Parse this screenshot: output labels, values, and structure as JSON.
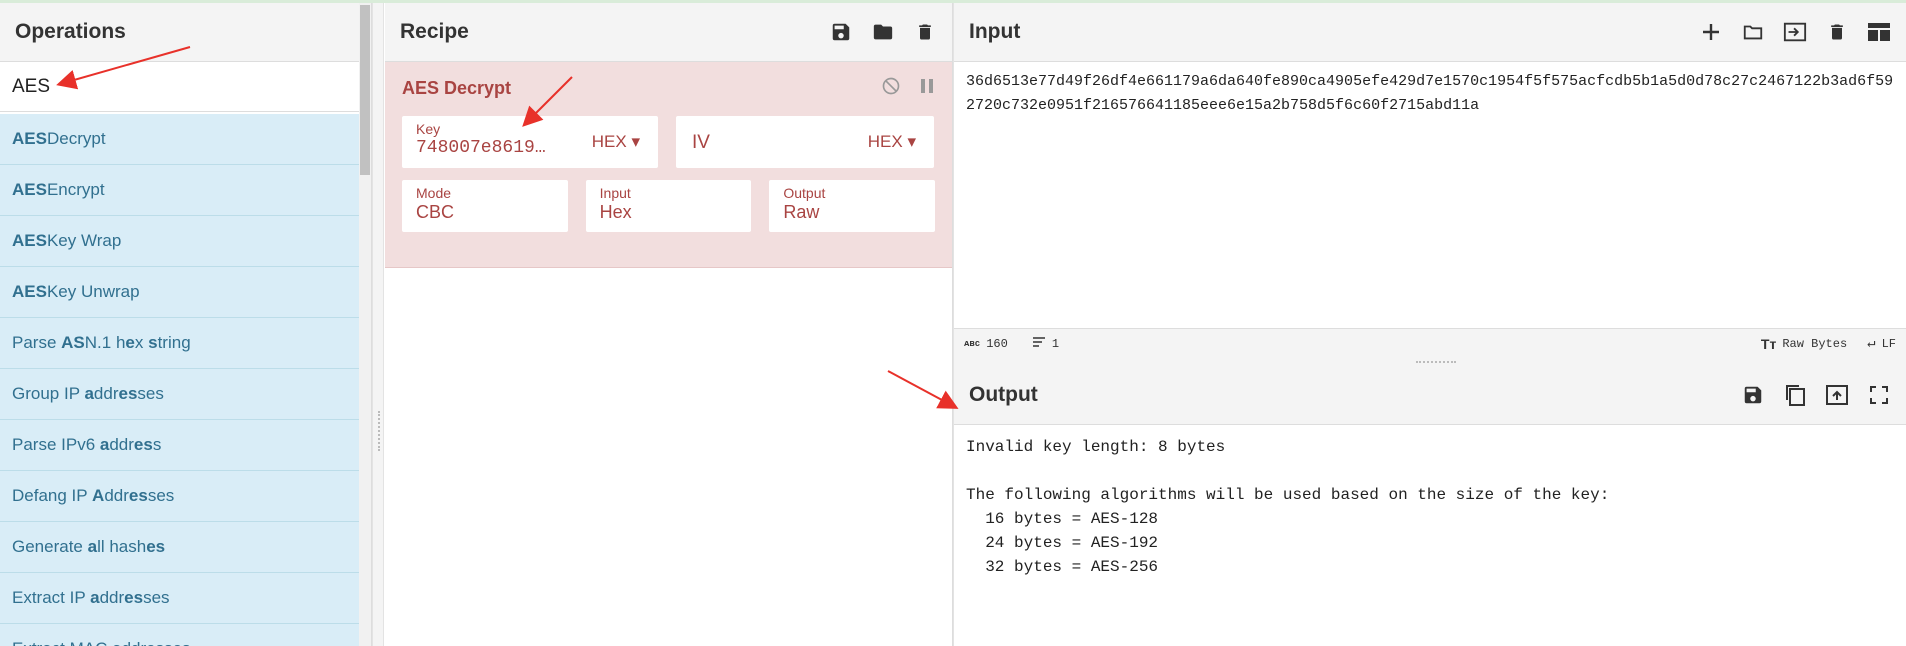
{
  "operations": {
    "title": "Operations",
    "search_value": "AES",
    "items": [
      {
        "match": "AES",
        "rest": " Decrypt"
      },
      {
        "match": "AES",
        "rest": " Encrypt"
      },
      {
        "match": "AES",
        "rest": " Key Wrap"
      },
      {
        "match": "AES",
        "rest": " Key Unwrap"
      },
      {
        "html": "Parse <b>AS</b>N.1 h<b>e</b>x <b>s</b>tring"
      },
      {
        "html": "Group IP <b>a</b>ddr<b>es</b>ses"
      },
      {
        "html": "Parse IPv6 <b>a</b>ddr<b>es</b>s"
      },
      {
        "html": "Defang IP <b>A</b>ddr<b>es</b>ses"
      },
      {
        "html": "Generate <b>a</b>ll hash<b>es</b>"
      },
      {
        "html": "Extract IP <b>a</b>ddr<b>es</b>ses"
      },
      {
        "html": "Extract MAC addresses"
      }
    ]
  },
  "recipe": {
    "title": "Recipe",
    "op_title": "AES Decrypt",
    "key_label": "Key",
    "key_value": "748007e8619…",
    "key_format": "HEX",
    "iv_placeholder": "IV",
    "iv_format": "HEX",
    "mode_label": "Mode",
    "mode_value": "CBC",
    "input_label": "Input",
    "input_value": "Hex",
    "output_label": "Output",
    "output_value": "Raw"
  },
  "input": {
    "title": "Input",
    "text": "36d6513e77d49f26df4e661179a6da640fe890ca4905efe429d7e1570c1954f5f575acfcdb5b1a5d0d78c27c2467122b3ad6f592720c732e0951f216576641185eee6e15a2b758d5f6c60f2715abd11a",
    "length": "160",
    "lines": "1",
    "encoding": "Raw Bytes",
    "eol": "LF"
  },
  "output": {
    "title": "Output",
    "text": "Invalid key length: 8 bytes\n\nThe following algorithms will be used based on the size of the key:\n  16 bytes = AES-128\n  24 bytes = AES-192\n  32 bytes = AES-256"
  },
  "colors": {
    "op_item_bg": "#d9edf7",
    "op_item_text": "#31708f",
    "recipe_card_bg": "#f2dede",
    "recipe_card_text": "#a94442",
    "annotation_arrow": "#e8312a"
  }
}
